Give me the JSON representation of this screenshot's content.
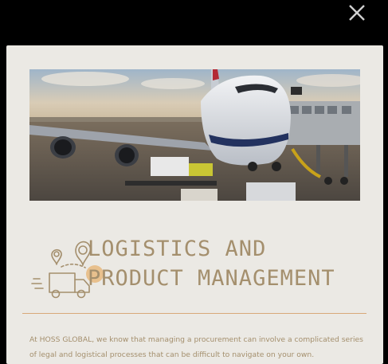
{
  "modal": {
    "close_icon": "close-icon",
    "hero_image": "airplane-loading-at-gate",
    "heading_icon": "delivery-truck-location-pins-icon",
    "heading_line1": "LOGISTICS AND",
    "heading_line2": "PRODUCT MANAGEMENT",
    "body_text": "At HOSS GLOBAL, we know that managing a procurement can involve a complicated series of legal and logistical processes that can be difficult to navigate on your own.",
    "colors": {
      "overlay": "#000000",
      "modal_bg": "#ebe9e4",
      "accent": "#a48f6d",
      "divider": "#d8a878"
    }
  }
}
